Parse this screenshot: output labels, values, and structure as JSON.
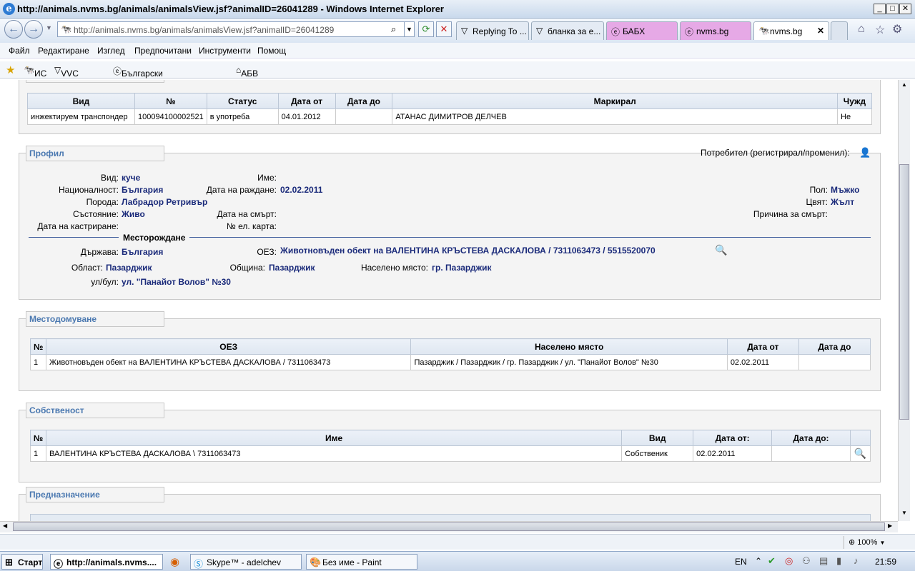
{
  "window": {
    "title": "http://animals.nvms.bg/animals/animalsView.jsf?animalID=26041289 - Windows Internet Explorer"
  },
  "address": {
    "url": "http://animals.nvms.bg/animals/animalsView.jsf?animalID=26041289"
  },
  "tabs": [
    {
      "label": "Replying To ..."
    },
    {
      "label": "бланка за е..."
    },
    {
      "label": "БАБХ"
    },
    {
      "label": "nvms.bg"
    },
    {
      "label": "nvms.bg"
    }
  ],
  "menu": [
    "Файл",
    "Редактиране",
    "Изглед",
    "Предпочитани",
    "Инструменти",
    "Помощ"
  ],
  "favorites": [
    "ИС",
    "VVC Форум",
    "Български Ветеринарен С...",
    "АБВ Поща"
  ],
  "marking": {
    "headers": [
      "Вид",
      "№",
      "Статус",
      "Дата от",
      "Дата до",
      "Маркирал",
      "Чужд"
    ],
    "rows": [
      [
        "инжектируем транспондер",
        "100094100002521",
        "в употреба",
        "04.01.2012",
        "",
        "АТАНАС ДИМИТРОВ ДЕЛЧЕВ",
        "Не"
      ]
    ]
  },
  "profile": {
    "legend": "Профил",
    "user_label": "Потребител (регистрирал/променил):",
    "species_label": "Вид:",
    "species": "куче",
    "name_label": "Име:",
    "nationality_label": "Националност:",
    "nationality": "България",
    "birthdate_label": "Дата на раждане:",
    "birthdate": "02.02.2011",
    "sex_label": "Пол:",
    "sex": "Мъжко",
    "breed_label": "Порода:",
    "breed": "Лабрадор Ретривър",
    "color_label": "Цвят:",
    "color": "Жълт",
    "state_label": "Състояние:",
    "state": "Живо",
    "deathdate_label": "Дата на смърт:",
    "deathcause_label": "Причина за смърт:",
    "castration_label": "Дата на кастриране:",
    "idcard_label": "№ ел. карта:",
    "birthplace_heading": "Месторождане",
    "country_label": "Държава:",
    "country": "България",
    "oez_label": "ОЕЗ:",
    "oez": "Животновъден обект на ВАЛЕНТИНА КРЪСТЕВА ДАСКАЛОВА / 7311063473 / 5515520070",
    "region_label": "Област:",
    "region": "Пазарджик",
    "municipality_label": "Община:",
    "municipality": "Пазарджик",
    "settlement_label": "Населено място:",
    "settlement": "гр. Пазарджик",
    "street_label": "ул/бул:",
    "street": "ул. \"Панайот Волов\" №30"
  },
  "residence": {
    "legend": "Местодомуване",
    "headers": [
      "№",
      "ОЕЗ",
      "Населено място",
      "Дата от",
      "Дата до"
    ],
    "rows": [
      [
        "1",
        "Животновъден обект на ВАЛЕНТИНА КРЪСТЕВА ДАСКАЛОВА / 7311063473",
        "Пазарджик / Пазарджик / гр. Пазарджик / ул. \"Панайот Волов\" №30",
        "02.02.2011",
        ""
      ]
    ]
  },
  "ownership": {
    "legend": "Собственост",
    "headers": [
      "№",
      "Име",
      "Вид",
      "Дата от:",
      "Дата до:",
      ""
    ],
    "rows": [
      [
        "1",
        "ВАЛЕНТИНА КРЪСТЕВА ДАСКАЛОВА \\ 7311063473",
        "Собственик",
        "02.02.2011",
        ""
      ]
    ]
  },
  "purpose": {
    "legend": "Предназначение"
  },
  "statusbar": {
    "zoom": "100%"
  },
  "taskbar": {
    "start": "Старт",
    "items": [
      "http://animals.nvms....",
      "Skype™ - adelchev",
      "Без име - Paint"
    ],
    "lang": "EN",
    "time": "21:59"
  }
}
